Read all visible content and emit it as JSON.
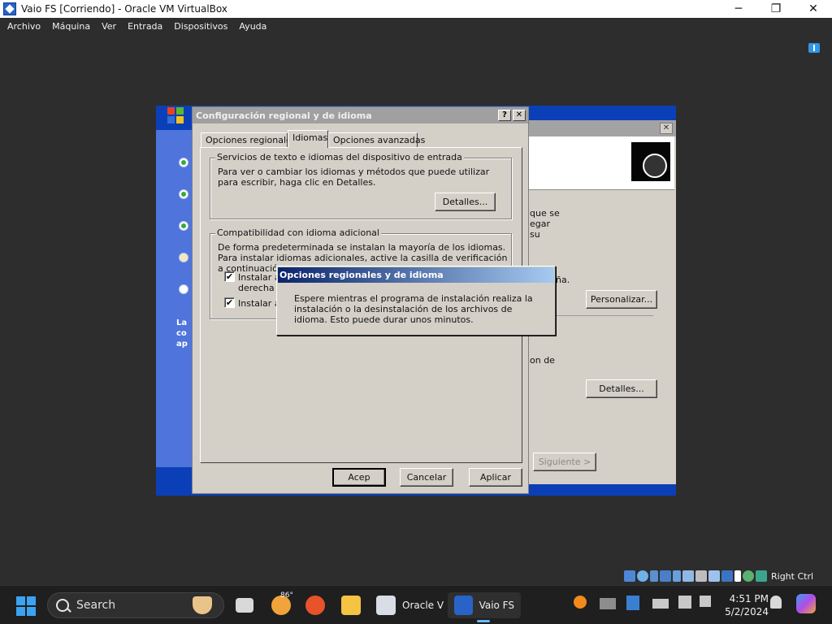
{
  "host": {
    "title": "Vaio FS [Corriendo] - Oracle VM VirtualBox",
    "window_buttons": [
      "─",
      "❐",
      "✕"
    ],
    "menu": [
      "Archivo",
      "Máquina",
      "Ver",
      "Entrada",
      "Dispositivos",
      "Ayuda"
    ],
    "host_key": "Right Ctrl"
  },
  "guest": {
    "side_text": [
      "La",
      "co",
      "ap"
    ],
    "setup_window": {
      "close_glyph": "✕",
      "text_lines": [
        "que se",
        "egar",
        "su"
      ],
      "text_tail": "ña.",
      "text_tail2": "on de",
      "personalize_label": "Personalizar...",
      "details_label": "Detalles...",
      "next_label": "Siguiente >"
    },
    "regional_dialog": {
      "title": "Configuración regional y de idioma",
      "help_glyph": "?",
      "close_glyph": "✕",
      "tabs": [
        "Opciones regionales",
        "Idiomas",
        "Opciones avanzadas"
      ],
      "active_tab": "Idiomas",
      "group1": {
        "legend": "Servicios de texto e idiomas del dispositivo de entrada",
        "text": "Para ver o cambiar los idiomas y métodos que puede utilizar para escribir, haga clic en Detalles.",
        "button": "Detalles..."
      },
      "group2": {
        "legend": "Compatibilidad con idioma adicional",
        "text": "De forma predeterminada se instalan la mayoría de los idiomas. Para instalar idiomas adicionales, active la casilla de verificación a continuación.",
        "checkbox1_line1": "Instalar ar",
        "checkbox1_line2": "derecha a",
        "checkbox2": "Instalar ar",
        "checked_glyph": "✔"
      },
      "ok_label": "Acep",
      "cancel_label": "Cancelar",
      "apply_label": "Aplicar"
    },
    "message_dialog": {
      "title": "Opciones regionales y de idioma",
      "text": "Espere mientras el programa de instalación realiza la instalación o la desinstalación de los archivos de idioma. Esto puede durar unos minutos."
    }
  },
  "taskbar": {
    "search_label": "Search",
    "weather_temp": "86°",
    "apps": [
      {
        "name": "Oracle V",
        "icon": "virtualbox-icon"
      },
      {
        "name": "Vaio FS",
        "icon": "vm-xp-icon"
      }
    ],
    "time": "4:51 PM",
    "date": "5/2/2024"
  },
  "colors": {
    "xp_blue": "#0b3fb8",
    "dialog_gray": "#d4d0c8",
    "active_title": "#0a246a",
    "windows_accent": "#3aa4f2"
  }
}
